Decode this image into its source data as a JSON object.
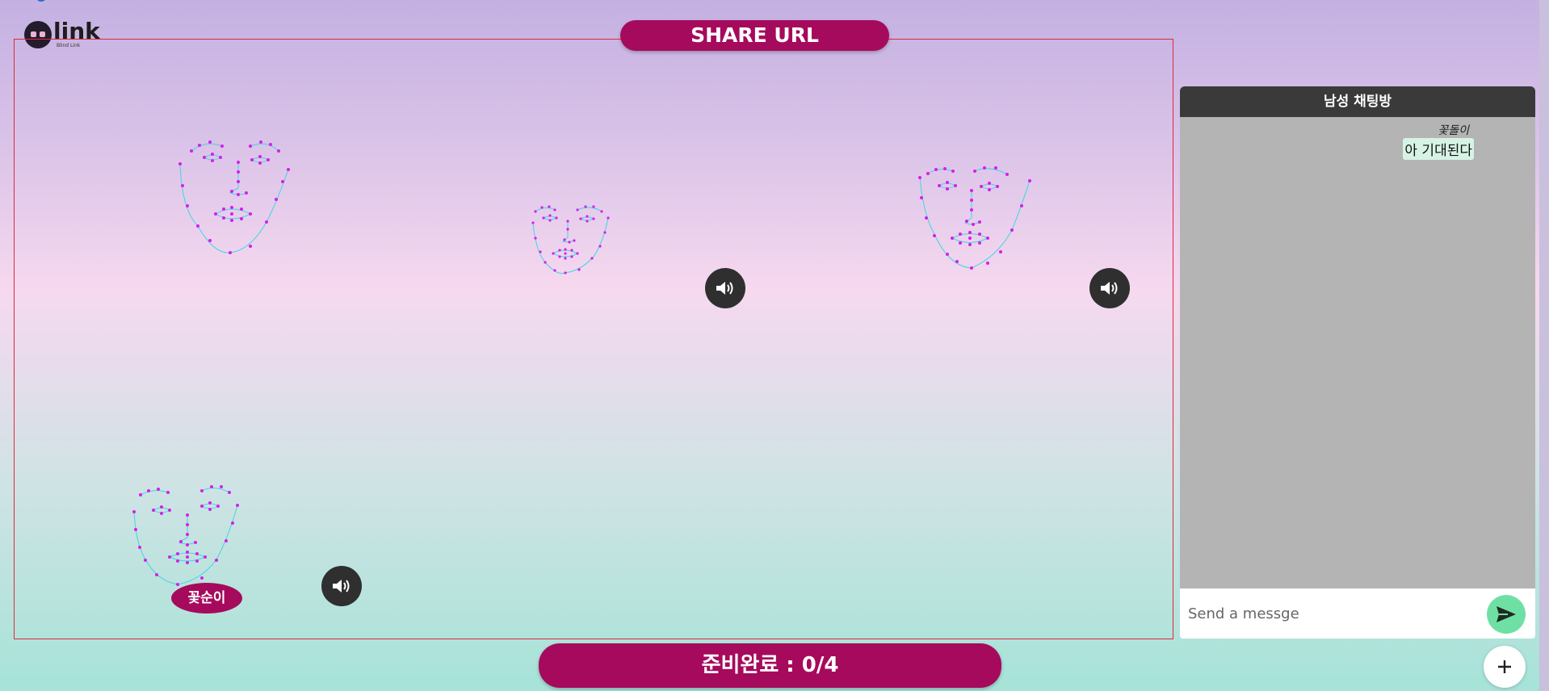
{
  "header": {
    "logo_text": "link",
    "logo_subtitle": "Blind Link",
    "share_label": "SHARE URL"
  },
  "participants": [
    {
      "name": "꽃순이",
      "has_sound_button": true
    }
  ],
  "footer": {
    "ready_label": "준비완료 : 0/4"
  },
  "chat": {
    "title": "남성 채팅방",
    "messages": [
      {
        "sender": "꽃돌이",
        "text": "아 기대된다"
      }
    ],
    "input_placeholder": "Send a messge"
  },
  "colors": {
    "accent": "#a60a5c",
    "face_dots": "#d61eea",
    "face_lines": "#3fd6e0",
    "send_button": "#6fe0a4",
    "chat_header": "#3a3a3a",
    "chat_body": "#b4b4b4"
  },
  "icons": {
    "sound": "speaker-icon",
    "send": "send-arrow-icon",
    "add": "plus-icon"
  }
}
